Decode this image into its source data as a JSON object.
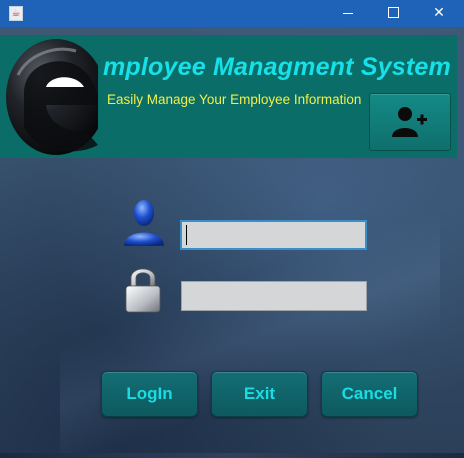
{
  "window": {
    "title": "",
    "controls": {
      "minimize_icon": "minimize-icon",
      "maximize_icon": "maximize-icon",
      "close_label": "✕"
    }
  },
  "header": {
    "logo_letter": "e",
    "title": "mployee Managment System",
    "subtitle": "Easily Manage Your Employee Information",
    "add_user_icon": "add-user-icon"
  },
  "form": {
    "username": {
      "icon": "user-icon",
      "value": "",
      "placeholder": ""
    },
    "password": {
      "icon": "lock-icon",
      "value": "",
      "placeholder": ""
    }
  },
  "buttons": {
    "login": "LogIn",
    "exit": "Exit",
    "cancel": "Cancel"
  },
  "colors": {
    "titlebar": "#1f63b8",
    "header_bg": "#0a6d67",
    "title_text": "#16e0e8",
    "subtitle_text": "#f0f04a",
    "button_bg": "#0f6369",
    "button_text": "#19dde3"
  }
}
